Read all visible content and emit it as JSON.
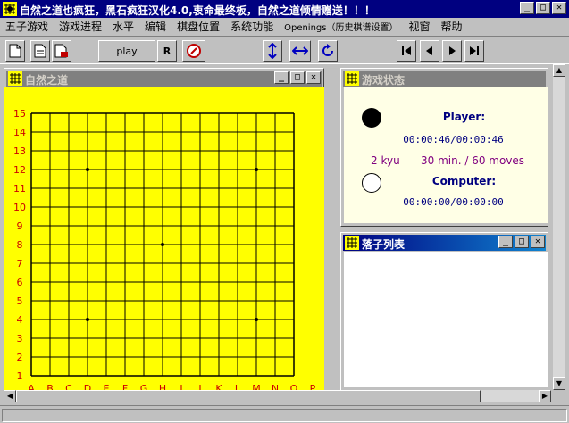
{
  "window": {
    "title": "自然之道也疯狂，黑石疯狂汉化4.0,衷命最终板，自然之道倾情赠送！！！",
    "controls": {
      "minimize": "_",
      "maximize": "□",
      "close": "✕"
    }
  },
  "menu": [
    {
      "label": "五子游戏"
    },
    {
      "label": "游戏进程"
    },
    {
      "label": "水平"
    },
    {
      "label": "编辑"
    },
    {
      "label": "棋盘位置"
    },
    {
      "label": "系统功能"
    },
    {
      "label": "Openings（历史棋谱设置）"
    },
    {
      "label": "视窗"
    },
    {
      "label": "帮助"
    }
  ],
  "toolbar": {
    "play_label": "play",
    "r_label": "R"
  },
  "board_panel": {
    "title": "自然之道"
  },
  "board": {
    "size": 15,
    "row_labels": [
      "15",
      "14",
      "13",
      "12",
      "11",
      "10",
      "9",
      "8",
      "7",
      "6",
      "5",
      "4",
      "3",
      "2",
      "1"
    ],
    "col_labels": [
      "A",
      "B",
      "C",
      "D",
      "E",
      "F",
      "G",
      "H",
      "I",
      "J",
      "K",
      "L",
      "M",
      "N",
      "O",
      "P"
    ],
    "background": "#ffff00",
    "label_color": "#cc0000",
    "star_points": [
      [
        "D",
        "12"
      ],
      [
        "M",
        "12"
      ],
      [
        "H",
        "8"
      ],
      [
        "D",
        "4"
      ],
      [
        "M",
        "4"
      ]
    ]
  },
  "status_panel": {
    "title": "游戏状态",
    "player_label": "Player:",
    "player_time": "00:00:46/00:00:46",
    "level": "2 kyu",
    "time_control": "30 min. / 60 moves",
    "computer_label": "Computer:",
    "computer_time": "00:00:00/00:00:00",
    "label_color": "#000080",
    "level_color": "#800080"
  },
  "moves_panel": {
    "title": "落子列表"
  }
}
